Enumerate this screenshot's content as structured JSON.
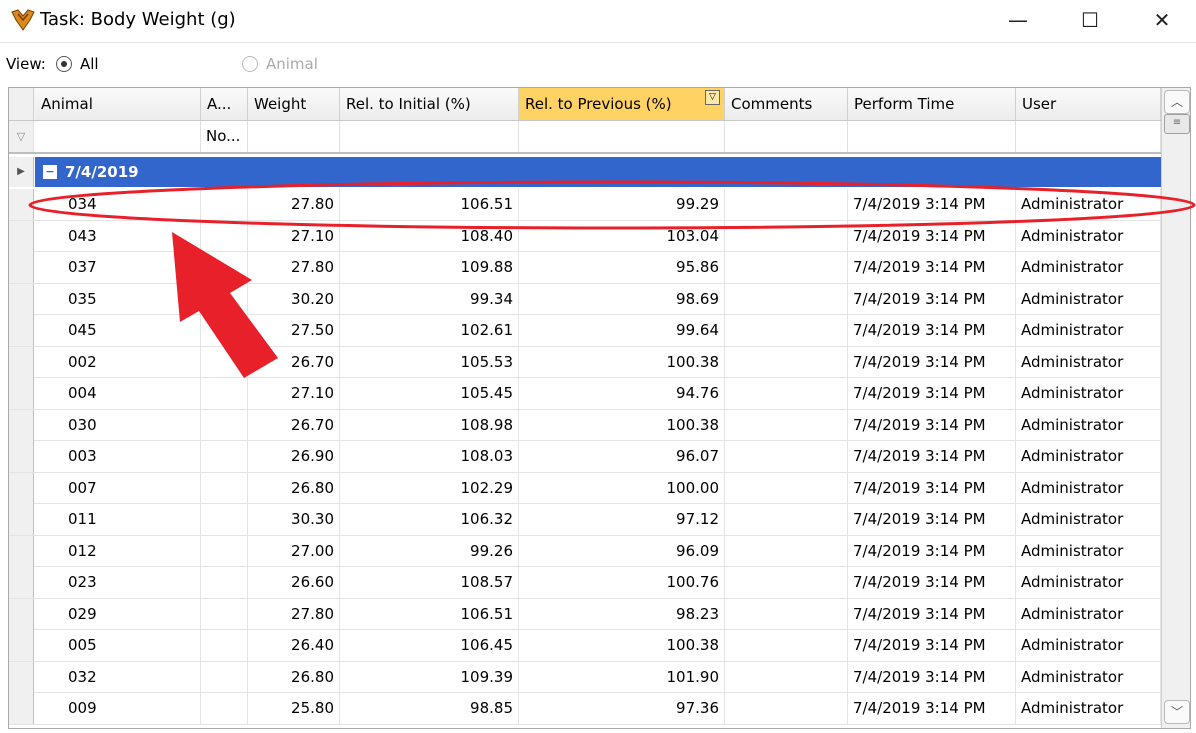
{
  "window": {
    "title": "Task: Body Weight (g)",
    "minimize_glyph": "—",
    "maximize_glyph": "☐",
    "close_glyph": "✕"
  },
  "view": {
    "label": "View:",
    "options": [
      {
        "label": "All",
        "selected": true,
        "enabled": true
      },
      {
        "label": "Animal",
        "selected": false,
        "enabled": false
      }
    ]
  },
  "grid": {
    "columns": [
      "Animal",
      "A...",
      "Weight",
      "Rel. to Initial (%)",
      "Rel. to Previous (%)",
      "Comments",
      "Perform Time",
      "User"
    ],
    "filter_row": [
      "",
      "No...",
      "",
      "",
      "",
      "",
      "",
      ""
    ],
    "sorted_column": "Rel. to Previous (%)",
    "group": {
      "label": "7/4/2019",
      "expanded": true
    },
    "rows": [
      {
        "animal": "034",
        "a": "",
        "weight": "27.80",
        "rel_initial": "106.51",
        "rel_previous": "99.29",
        "comments": "",
        "time": "7/4/2019 3:14 PM",
        "user": "Administrator"
      },
      {
        "animal": "043",
        "a": "",
        "weight": "27.10",
        "rel_initial": "108.40",
        "rel_previous": "103.04",
        "comments": "",
        "time": "7/4/2019 3:14 PM",
        "user": "Administrator"
      },
      {
        "animal": "037",
        "a": "",
        "weight": "27.80",
        "rel_initial": "109.88",
        "rel_previous": "95.86",
        "comments": "",
        "time": "7/4/2019 3:14 PM",
        "user": "Administrator"
      },
      {
        "animal": "035",
        "a": "",
        "weight": "30.20",
        "rel_initial": "99.34",
        "rel_previous": "98.69",
        "comments": "",
        "time": "7/4/2019 3:14 PM",
        "user": "Administrator"
      },
      {
        "animal": "045",
        "a": "",
        "weight": "27.50",
        "rel_initial": "102.61",
        "rel_previous": "99.64",
        "comments": "",
        "time": "7/4/2019 3:14 PM",
        "user": "Administrator"
      },
      {
        "animal": "002",
        "a": "",
        "weight": "26.70",
        "rel_initial": "105.53",
        "rel_previous": "100.38",
        "comments": "",
        "time": "7/4/2019 3:14 PM",
        "user": "Administrator"
      },
      {
        "animal": "004",
        "a": "",
        "weight": "27.10",
        "rel_initial": "105.45",
        "rel_previous": "94.76",
        "comments": "",
        "time": "7/4/2019 3:14 PM",
        "user": "Administrator"
      },
      {
        "animal": "030",
        "a": "",
        "weight": "26.70",
        "rel_initial": "108.98",
        "rel_previous": "100.38",
        "comments": "",
        "time": "7/4/2019 3:14 PM",
        "user": "Administrator"
      },
      {
        "animal": "003",
        "a": "",
        "weight": "26.90",
        "rel_initial": "108.03",
        "rel_previous": "96.07",
        "comments": "",
        "time": "7/4/2019 3:14 PM",
        "user": "Administrator"
      },
      {
        "animal": "007",
        "a": "",
        "weight": "26.80",
        "rel_initial": "102.29",
        "rel_previous": "100.00",
        "comments": "",
        "time": "7/4/2019 3:14 PM",
        "user": "Administrator"
      },
      {
        "animal": "011",
        "a": "",
        "weight": "30.30",
        "rel_initial": "106.32",
        "rel_previous": "97.12",
        "comments": "",
        "time": "7/4/2019 3:14 PM",
        "user": "Administrator"
      },
      {
        "animal": "012",
        "a": "",
        "weight": "27.00",
        "rel_initial": "99.26",
        "rel_previous": "96.09",
        "comments": "",
        "time": "7/4/2019 3:14 PM",
        "user": "Administrator"
      },
      {
        "animal": "023",
        "a": "",
        "weight": "26.60",
        "rel_initial": "108.57",
        "rel_previous": "100.76",
        "comments": "",
        "time": "7/4/2019 3:14 PM",
        "user": "Administrator"
      },
      {
        "animal": "029",
        "a": "",
        "weight": "27.80",
        "rel_initial": "106.51",
        "rel_previous": "98.23",
        "comments": "",
        "time": "7/4/2019 3:14 PM",
        "user": "Administrator"
      },
      {
        "animal": "005",
        "a": "",
        "weight": "26.40",
        "rel_initial": "106.45",
        "rel_previous": "100.38",
        "comments": "",
        "time": "7/4/2019 3:14 PM",
        "user": "Administrator"
      },
      {
        "animal": "032",
        "a": "",
        "weight": "26.80",
        "rel_initial": "109.39",
        "rel_previous": "101.90",
        "comments": "",
        "time": "7/4/2019 3:14 PM",
        "user": "Administrator"
      },
      {
        "animal": "009",
        "a": "",
        "weight": "25.80",
        "rel_initial": "98.85",
        "rel_previous": "97.36",
        "comments": "",
        "time": "7/4/2019 3:14 PM",
        "user": "Administrator"
      }
    ]
  },
  "colors": {
    "group_band": "#3366cc",
    "sorted_header": "#ffd264",
    "annotation": "#e8202a"
  },
  "icons": {
    "app": "app-logo-icon",
    "filter": "filter-icon",
    "sort": "sort-filter-icon",
    "collapse": "collapse-icon",
    "row_indicator": "row-indicator-icon",
    "scroll_up": "chevron-up-icon",
    "scroll_down": "chevron-down-icon"
  }
}
